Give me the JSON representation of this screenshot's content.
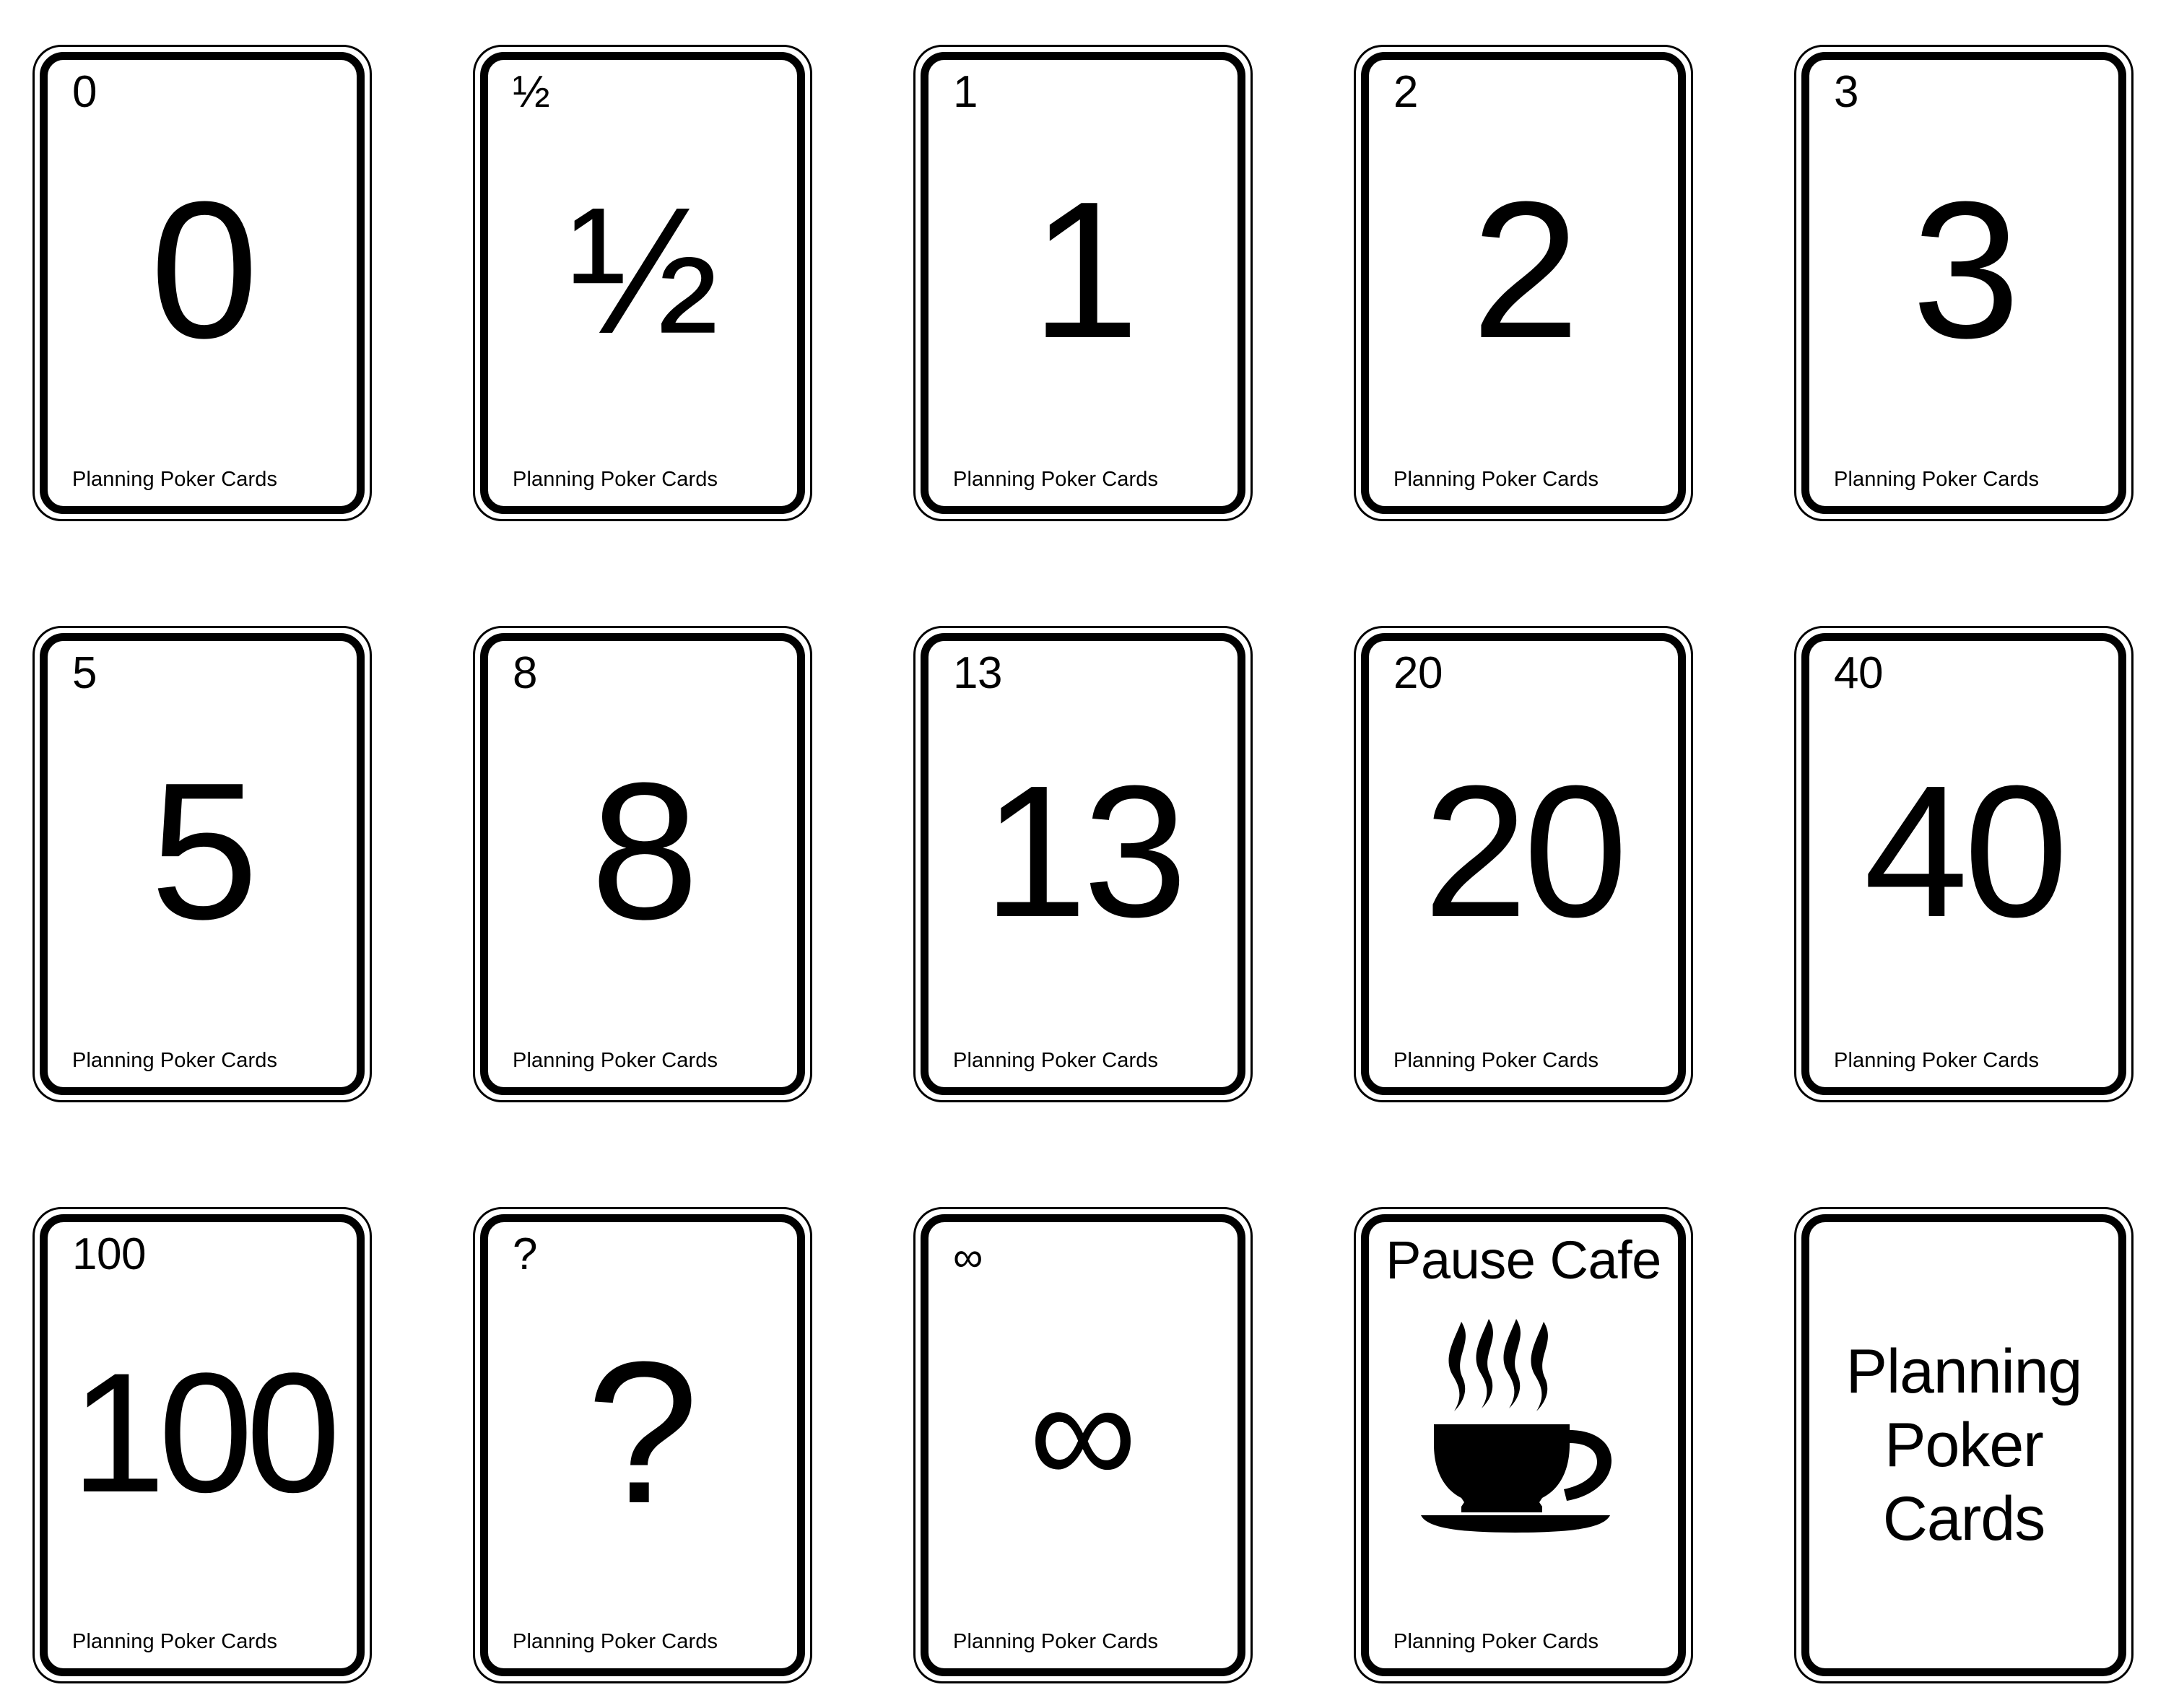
{
  "deck": {
    "title": "Planning Poker Cards",
    "footer_label": "Planning Poker Cards",
    "columns": 5,
    "rows": 3,
    "card_count": 15,
    "colors": {
      "ink": "#000000",
      "paper": "#ffffff"
    },
    "back_title_lines": [
      "Planning",
      "Poker",
      "Cards"
    ],
    "cafe_title": "Pause Cafe",
    "cafe_icon": "coffee-cup-icon",
    "cards": [
      {
        "id": "card-0",
        "kind": "value",
        "corner_value": "0",
        "main_value": "0",
        "footer": "Planning Poker Cards",
        "size_class": "one-digit"
      },
      {
        "id": "card-half",
        "kind": "value",
        "corner_value": "½",
        "main_value": "½",
        "footer": "Planning Poker Cards",
        "size_class": "frac"
      },
      {
        "id": "card-1",
        "kind": "value",
        "corner_value": "1",
        "main_value": "1",
        "footer": "Planning Poker Cards",
        "size_class": "one-digit"
      },
      {
        "id": "card-2",
        "kind": "value",
        "corner_value": "2",
        "main_value": "2",
        "footer": "Planning Poker Cards",
        "size_class": "one-digit"
      },
      {
        "id": "card-3",
        "kind": "value",
        "corner_value": "3",
        "main_value": "3",
        "footer": "Planning Poker Cards",
        "size_class": "one-digit"
      },
      {
        "id": "card-5",
        "kind": "value",
        "corner_value": "5",
        "main_value": "5",
        "footer": "Planning Poker Cards",
        "size_class": "one-digit"
      },
      {
        "id": "card-8",
        "kind": "value",
        "corner_value": "8",
        "main_value": "8",
        "footer": "Planning Poker Cards",
        "size_class": "one-digit"
      },
      {
        "id": "card-13",
        "kind": "value",
        "corner_value": "13",
        "main_value": "13",
        "footer": "Planning Poker Cards",
        "size_class": "two-digit"
      },
      {
        "id": "card-20",
        "kind": "value",
        "corner_value": "20",
        "main_value": "20",
        "footer": "Planning Poker Cards",
        "size_class": "two-digit"
      },
      {
        "id": "card-40",
        "kind": "value",
        "corner_value": "40",
        "main_value": "40",
        "footer": "Planning Poker Cards",
        "size_class": "two-digit"
      },
      {
        "id": "card-100",
        "kind": "value",
        "corner_value": "100",
        "main_value": "100",
        "footer": "Planning Poker Cards",
        "size_class": "three-digit"
      },
      {
        "id": "card-question",
        "kind": "value",
        "corner_value": "?",
        "main_value": "?",
        "footer": "Planning Poker Cards",
        "size_class": "qmark"
      },
      {
        "id": "card-infinity",
        "kind": "value",
        "corner_value": "∞",
        "main_value": "∞",
        "footer": "Planning Poker Cards",
        "size_class": "inf"
      },
      {
        "id": "card-pause-cafe",
        "kind": "cafe",
        "title": "Pause Cafe",
        "icon": "coffee-cup-icon",
        "footer": "Planning Poker Cards"
      },
      {
        "id": "card-back",
        "kind": "back",
        "lines": [
          "Planning",
          "Poker",
          "Cards"
        ]
      }
    ]
  }
}
